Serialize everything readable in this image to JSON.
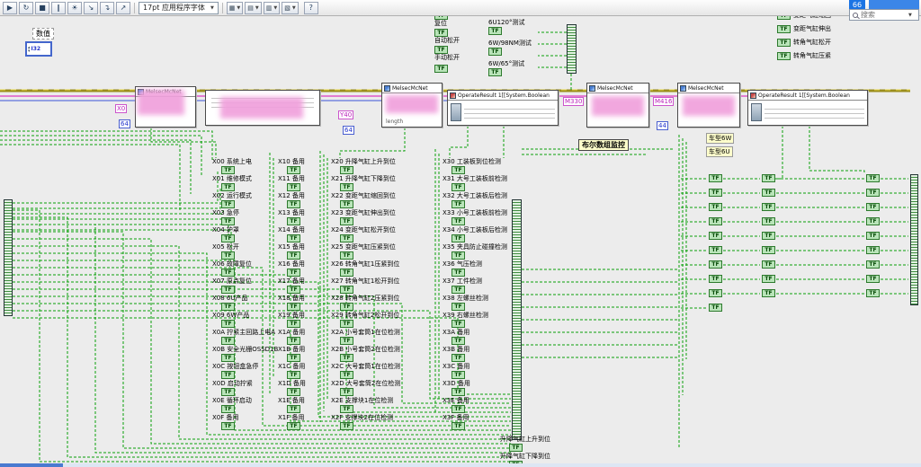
{
  "toolbar": {
    "buttons": [
      {
        "name": "run",
        "glyph": "▶"
      },
      {
        "name": "run-continuous",
        "glyph": "↻"
      },
      {
        "name": "abort",
        "glyph": "■"
      },
      {
        "name": "pause",
        "glyph": "∥"
      },
      {
        "name": "highlight-execution",
        "glyph": "☀"
      },
      {
        "name": "step-into",
        "glyph": "↘"
      },
      {
        "name": "step-over",
        "glyph": "↴"
      },
      {
        "name": "step-out",
        "glyph": "↗"
      }
    ],
    "font_selector": "17pt 应用程序字体",
    "dropdowns": [
      {
        "name": "align-objects",
        "glyph": "▦"
      },
      {
        "name": "distribute-objects",
        "glyph": "▤"
      },
      {
        "name": "resize-objects",
        "glyph": "▥"
      },
      {
        "name": "reorder-objects",
        "glyph": "▧"
      }
    ],
    "help": "?",
    "badge": "66",
    "search_placeholder": "搜索"
  },
  "glyphs": {
    "tf": "TF",
    "caret": "▼"
  },
  "colors": {
    "boolean_wire": "#0aa00a",
    "cluster_wire": "#9b8e1e",
    "string_wire": "#e058c8",
    "numeric_wire": "#3a55d8",
    "blur_pink": "#f0a0dc"
  },
  "nodes": {
    "melsec": "MelsecMcNet",
    "operate": "OperateResult 1[[System.Boolean",
    "length_label": "length"
  },
  "consts": {
    "x0": "X0",
    "c64a": "64",
    "y40": "Y40",
    "c64b": "64",
    "m330": "M330",
    "m416": "M416",
    "c44": "44"
  },
  "labels": {
    "numeric_title": "数值",
    "numeric_repr": "I32",
    "bool_monitor": "布尔数组监控",
    "car6w": "车型6W",
    "car6u": "车型6U"
  },
  "top": {
    "reset": [
      "复位",
      "自动松开",
      "手动松开"
    ],
    "tests": [
      "6U120°测试",
      "6W/98NM测试",
      "6W/65°测试"
    ],
    "right": [
      "变距气缸缩回",
      "变距气缸伸出",
      "转角气缸松开",
      "转角气缸压紧"
    ]
  },
  "signals": {
    "x0": [
      "X00 系统上电",
      "X01 维修模式",
      "X02 运行模式",
      "X03 急停",
      "X04 护罩",
      "X05 松开",
      "X06 故障复位",
      "X07 原点复位",
      "X08 6U产品",
      "X09 6W产品",
      "X0A 拧紧主回路上电A",
      "X0B 安全光栅OSSD1B",
      "X0C 按钮盒急停",
      "X0D 启动拧紧",
      "X0E 循环启动",
      "X0F 备用"
    ],
    "x1": [
      "X10 备用",
      "X11 备用",
      "X12 备用",
      "X13 备用",
      "X14 备用",
      "X15 备用",
      "X16 备用",
      "X17 备用",
      "X18 备用",
      "X19 备用",
      "X1A 备用",
      "X1B 备用",
      "X1C 备用",
      "X1D 备用",
      "X1E 备用",
      "X1F 备用"
    ],
    "x2": [
      "X20 升降气缸上升到位",
      "X21 升降气缸下降到位",
      "X22 变距气缸缩回到位",
      "X23 变距气缸伸出到位",
      "X24 变距气缸松开到位",
      "X25 变距气缸压紧到位",
      "X26 转角气缸1压紧到位",
      "X27 转角气缸1松开到位",
      "X28 转角气缸2压紧到位",
      "X29 转角气缸2松开到位",
      "X2A 小号套筒1在位检测",
      "X2B 小号套筒2在位检测",
      "X2C 大号套筒1在位检测",
      "X2D 大号套筒2在位检测",
      "X2E 支撑块1在位检测",
      "X2F 支撑块2在位检测"
    ],
    "x3": [
      "X30 工装板到位检测",
      "X31 大号工装板前检测",
      "X32 大号工装板后检测",
      "X33 小号工装板前检测",
      "X34 小号工装板后检测",
      "X35 夹具防止碰撞检测",
      "X36 气压检测",
      "X37 工件检测",
      "X38 左螺丝检测",
      "X39 右螺丝检测",
      "X3A 备用",
      "X3B 备用",
      "X3C 备用",
      "X3D 备用",
      "X3E 备用",
      "X3F 备用"
    ]
  },
  "bottom": [
    "升降气缸上升到位",
    "升降气缸下降到位"
  ]
}
